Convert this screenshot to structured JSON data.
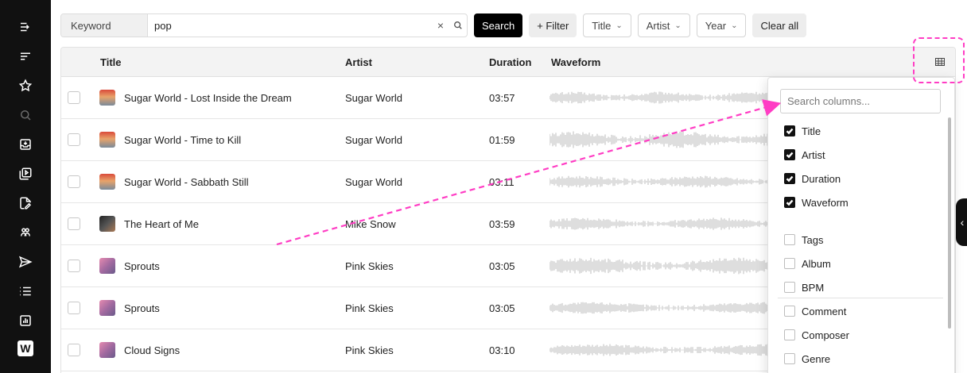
{
  "sidebar": {
    "items": [
      {
        "icon": "expand-sidebar-icon"
      },
      {
        "icon": "sort-lines-icon"
      },
      {
        "icon": "star-icon"
      },
      {
        "icon": "search-icon"
      },
      {
        "icon": "inbox-icon"
      },
      {
        "icon": "playlist-icon"
      },
      {
        "icon": "edit-file-icon"
      },
      {
        "icon": "community-icon"
      },
      {
        "icon": "send-icon"
      },
      {
        "icon": "list-icon"
      },
      {
        "icon": "chart-icon"
      },
      {
        "icon": "w-logo-icon",
        "text": "W"
      }
    ]
  },
  "toolbar": {
    "keyword_label": "Keyword",
    "keyword_value": "pop",
    "clear_symbol": "×",
    "search_label": "Search",
    "filter_label": "+ Filter",
    "title_dropdown": "Title",
    "artist_dropdown": "Artist",
    "year_dropdown": "Year",
    "clear_all_label": "Clear all"
  },
  "table": {
    "columns": [
      "Title",
      "Artist",
      "Duration",
      "Waveform"
    ],
    "rows": [
      {
        "title": "Sugar World - Lost Inside the Dream",
        "artist": "Sugar World",
        "duration": "03:57",
        "thumb": "t1"
      },
      {
        "title": "Sugar World - Time to Kill",
        "artist": "Sugar World",
        "duration": "01:59",
        "thumb": "t1"
      },
      {
        "title": "Sugar World - Sabbath Still",
        "artist": "Sugar World",
        "duration": "03:11",
        "thumb": "t1"
      },
      {
        "title": "The Heart of Me",
        "artist": "Mike Snow",
        "duration": "03:59",
        "thumb": "t2"
      },
      {
        "title": "Sprouts",
        "artist": "Pink Skies",
        "duration": "03:05",
        "thumb": "t3"
      },
      {
        "title": "Sprouts",
        "artist": "Pink Skies",
        "duration": "03:05",
        "thumb": "t3"
      },
      {
        "title": "Cloud Signs",
        "artist": "Pink Skies",
        "duration": "03:10",
        "thumb": "t3"
      }
    ]
  },
  "column_picker": {
    "search_placeholder": "Search columns...",
    "visible": [
      {
        "label": "Title",
        "checked": true
      },
      {
        "label": "Artist",
        "checked": true
      },
      {
        "label": "Duration",
        "checked": true
      },
      {
        "label": "Waveform",
        "checked": true
      }
    ],
    "hidden": [
      {
        "label": "Tags",
        "checked": false
      },
      {
        "label": "Album",
        "checked": false
      },
      {
        "label": "BPM",
        "checked": false
      },
      {
        "label": "Comment",
        "checked": false
      },
      {
        "label": "Composer",
        "checked": false
      },
      {
        "label": "Genre",
        "checked": false
      }
    ]
  },
  "colors": {
    "annotation": "#ff3dc4",
    "sidebar_bg": "#111111",
    "waveform": "#bdbdbd"
  }
}
